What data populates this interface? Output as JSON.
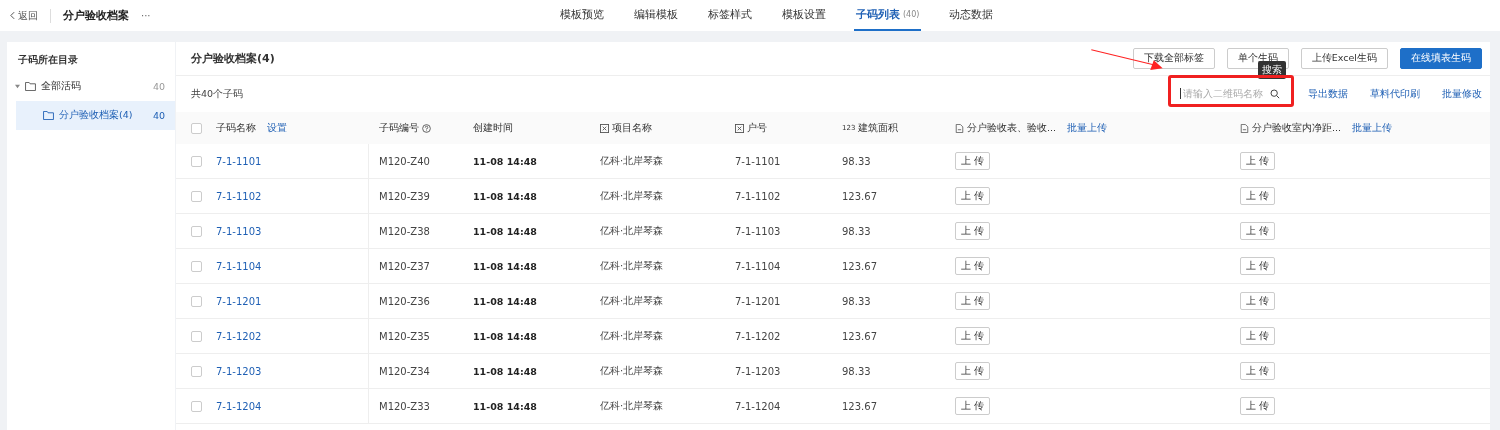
{
  "topbar": {
    "back": "返回",
    "title": "分户验收档案",
    "more": "···"
  },
  "tabs": [
    {
      "label": "模板预览",
      "selected": false
    },
    {
      "label": "编辑模板",
      "selected": false
    },
    {
      "label": "标签样式",
      "selected": false
    },
    {
      "label": "模板设置",
      "selected": false
    },
    {
      "label": "子码列表",
      "count": "(40)",
      "selected": true
    },
    {
      "label": "动态数据",
      "selected": false
    }
  ],
  "sidebar": {
    "title": "子码所在目录",
    "items": [
      {
        "label": "全部活码",
        "count": "40",
        "selected": false,
        "expanded": true,
        "children": [
          {
            "label": "分户验收档案(4)",
            "count": "40",
            "selected": true
          }
        ]
      }
    ]
  },
  "panel": {
    "title": "分户验收档案(4)",
    "buttons": [
      {
        "label": "下载全部标签",
        "kind": "default"
      },
      {
        "label": "单个生码",
        "kind": "default"
      },
      {
        "label": "上传Excel生码",
        "kind": "default"
      },
      {
        "label": "在线填表生码",
        "kind": "primary"
      }
    ],
    "total": "共40个子码",
    "search": {
      "placeholder": "请输入二维码名称",
      "tooltip": "搜索"
    },
    "links": [
      "导出数据",
      "草料代印刷",
      "批量修改"
    ]
  },
  "table": {
    "header_checked": false,
    "columns": [
      {
        "label": "子码名称",
        "kind": "plain",
        "link": "设置"
      },
      {
        "label": "子码编号",
        "kind": "help"
      },
      {
        "label": "创建时间",
        "kind": "plain"
      },
      {
        "label": "项目名称",
        "kind": "field"
      },
      {
        "label": "户号",
        "kind": "field"
      },
      {
        "label": "建筑面积",
        "kind": "number",
        "prefix": "123"
      },
      {
        "label": "分户验收表、验收...",
        "kind": "file",
        "link": "批量上传"
      },
      {
        "label": "分户验收室内净距...",
        "kind": "file",
        "link": "批量上传"
      }
    ],
    "rows": [
      {
        "checked": false,
        "cells": [
          "7-1-1101",
          "M120-Z40",
          "11-08 14:48",
          "亿科·北岸琴森",
          "7-1-1101",
          "98.33",
          "上 传",
          "上 传"
        ]
      },
      {
        "checked": false,
        "cells": [
          "7-1-1102",
          "M120-Z39",
          "11-08 14:48",
          "亿科·北岸琴森",
          "7-1-1102",
          "123.67",
          "上 传",
          "上 传"
        ]
      },
      {
        "checked": false,
        "cells": [
          "7-1-1103",
          "M120-Z38",
          "11-08 14:48",
          "亿科·北岸琴森",
          "7-1-1103",
          "98.33",
          "上 传",
          "上 传"
        ]
      },
      {
        "checked": false,
        "cells": [
          "7-1-1104",
          "M120-Z37",
          "11-08 14:48",
          "亿科·北岸琴森",
          "7-1-1104",
          "123.67",
          "上 传",
          "上 传"
        ]
      },
      {
        "checked": false,
        "cells": [
          "7-1-1201",
          "M120-Z36",
          "11-08 14:48",
          "亿科·北岸琴森",
          "7-1-1201",
          "98.33",
          "上 传",
          "上 传"
        ]
      },
      {
        "checked": false,
        "cells": [
          "7-1-1202",
          "M120-Z35",
          "11-08 14:48",
          "亿科·北岸琴森",
          "7-1-1202",
          "123.67",
          "上 传",
          "上 传"
        ]
      },
      {
        "checked": false,
        "cells": [
          "7-1-1203",
          "M120-Z34",
          "11-08 14:48",
          "亿科·北岸琴森",
          "7-1-1203",
          "98.33",
          "上 传",
          "上 传"
        ]
      },
      {
        "checked": false,
        "cells": [
          "7-1-1204",
          "M120-Z33",
          "11-08 14:48",
          "亿科·北岸琴森",
          "7-1-1204",
          "123.67",
          "上 传",
          "上 传"
        ]
      }
    ]
  }
}
